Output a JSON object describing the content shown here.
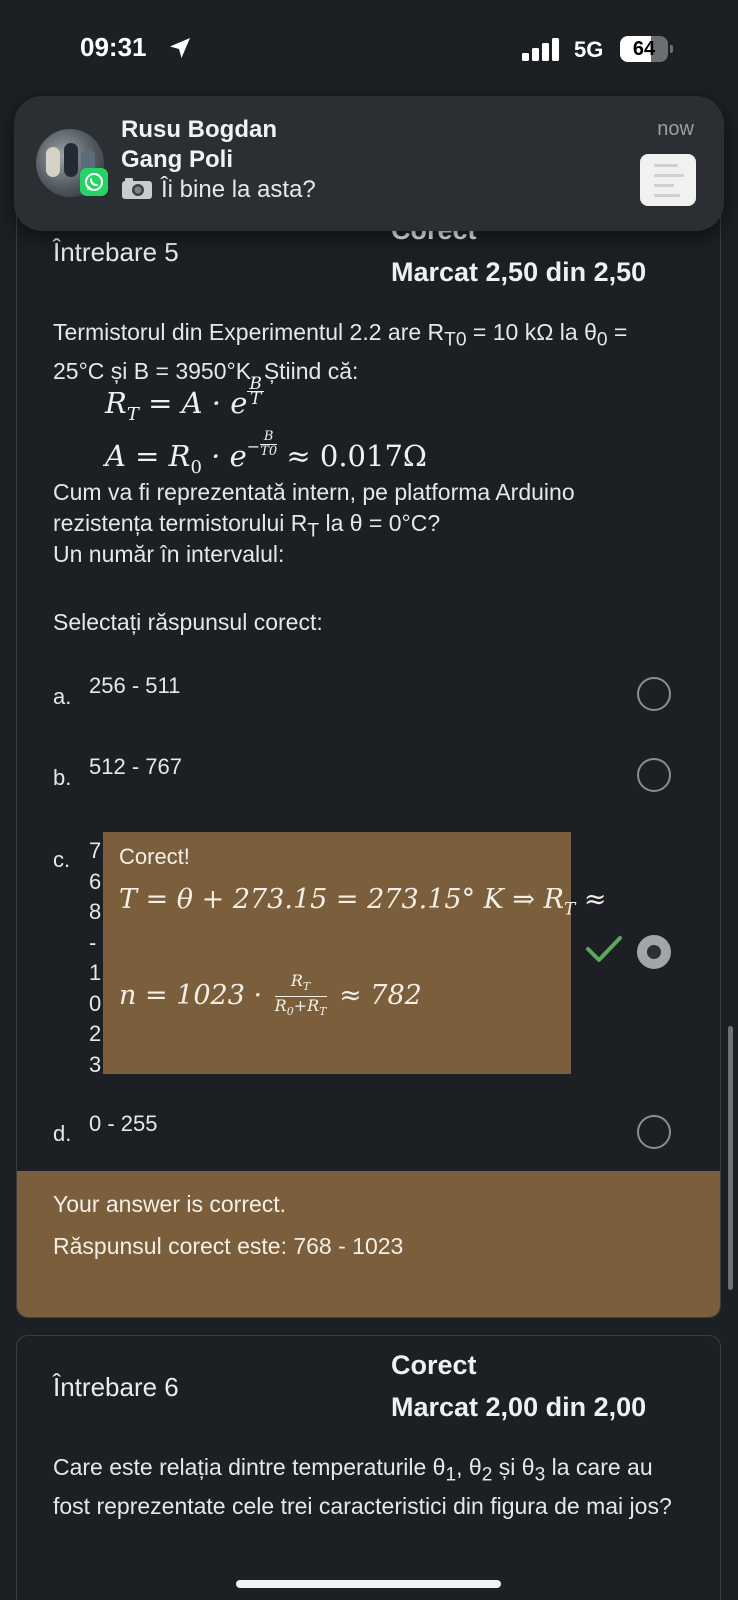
{
  "status_bar": {
    "time": "09:31",
    "network": "5G",
    "battery": "64",
    "battery_level": 0.64
  },
  "notification": {
    "sender": "Rusu Bogdan",
    "group": "Gang Poli",
    "message": "Îi bine la asta?",
    "time": "now",
    "app_icon": "whatsapp-icon",
    "attachment_icon": "camera-icon"
  },
  "question5": {
    "title": "Întrebare 5",
    "status": "Corect",
    "grade": "Marcat 2,50 din 2,50",
    "text_part1": "Termistorul din Experimentul 2.2 are R",
    "sub_T0": "T0",
    "text_part2": " = 10 kΩ la θ",
    "sub_0": "0",
    "text_part3": " = 25°C și B = 3950°K. Știind că:",
    "formula1": {
      "lhs": "R",
      "lhs_sub": "T",
      "mid": " = A · e",
      "exp_num": "B",
      "exp_den": "T"
    },
    "formula2": {
      "lhs": "A = R",
      "lhs_sub": "0",
      "mid": " · e",
      "exp_minus": "−",
      "exp_num": "B",
      "exp_den": "T0",
      "rhs": " ≈ 0.017Ω"
    },
    "text2_a": "Cum va fi reprezentată intern, pe platforma Arduino rezistența termistorului R",
    "text2_sub": "T",
    "text2_b": " la θ = 0°C?",
    "text3": "Un număr în intervalul:",
    "prompt": "Selectați răspunsul corect:",
    "options": [
      {
        "letter": "a.",
        "text": "256 - 511"
      },
      {
        "letter": "b.",
        "text": "512 - 767"
      },
      {
        "letter": "c.",
        "text": "768 - 1023"
      },
      {
        "letter": "d.",
        "text": "0 - 255"
      }
    ],
    "option_c_visible_chars": [
      "7",
      "6",
      "8",
      "-",
      "1",
      "0",
      "2",
      "3"
    ],
    "selected_option": "c",
    "tooltip": {
      "heading": "Corect!",
      "eq1": "T = θ + 273.15 = 273.15° K ⇒ R",
      "eq1_sub": "T",
      "eq1_tail": " ≈",
      "eq2_left": "n = 1023 ·",
      "eq2_num": "R",
      "eq2_num_sub": "T",
      "eq2_den": "R",
      "eq2_den_sub0": "0",
      "eq2_den_plus": "+R",
      "eq2_den_sub": "T",
      "eq2_right": "≈ 782"
    },
    "feedback_line1": "Your answer is correct.",
    "feedback_line2": "Răspunsul corect este: 768 - 1023"
  },
  "question6": {
    "title": "Întrebare 6",
    "status": "Corect",
    "grade": "Marcat 2,00 din 2,00",
    "text_a": "Care este relația dintre temperaturile θ",
    "sub1": "1",
    "text_b": ", θ",
    "sub2": "2",
    "text_c": " și θ",
    "sub3": "3",
    "text_d": " la care au fost reprezentate cele trei caracteristici din figura de mai jos?"
  },
  "colors": {
    "background": "#1c1f23",
    "feedback_bg": "#7b5f3c",
    "check_green": "#5aa85a"
  }
}
